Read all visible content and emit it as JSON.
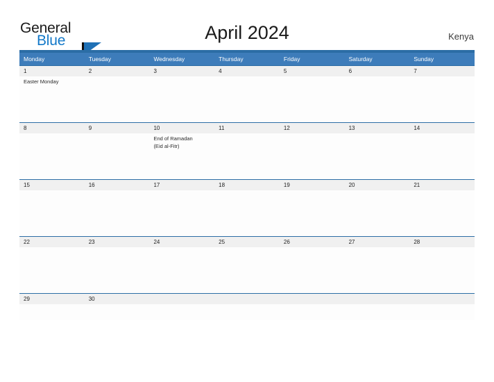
{
  "brand": {
    "name_part1": "General",
    "name_part2": "Blue",
    "accent_color": "#1278c8",
    "flag_color": "#1f70b5"
  },
  "header": {
    "title": "April 2024",
    "country": "Kenya",
    "rule_color": "#2b6da5",
    "weekday_header_bg": "#3d7cba"
  },
  "weekdays": [
    {
      "label": "Monday"
    },
    {
      "label": "Tuesday"
    },
    {
      "label": "Wednesday"
    },
    {
      "label": "Thursday"
    },
    {
      "label": "Friday"
    },
    {
      "label": "Saturday"
    },
    {
      "label": "Sunday"
    }
  ],
  "weeks": [
    {
      "days": [
        {
          "num": "1",
          "events": [
            "Easter Monday"
          ]
        },
        {
          "num": "2",
          "events": []
        },
        {
          "num": "3",
          "events": []
        },
        {
          "num": "4",
          "events": []
        },
        {
          "num": "5",
          "events": []
        },
        {
          "num": "6",
          "events": []
        },
        {
          "num": "7",
          "events": []
        }
      ]
    },
    {
      "days": [
        {
          "num": "8",
          "events": []
        },
        {
          "num": "9",
          "events": []
        },
        {
          "num": "10",
          "events": [
            "End of Ramadan",
            "(Eid al-Fitr)"
          ]
        },
        {
          "num": "11",
          "events": []
        },
        {
          "num": "12",
          "events": []
        },
        {
          "num": "13",
          "events": []
        },
        {
          "num": "14",
          "events": []
        }
      ]
    },
    {
      "days": [
        {
          "num": "15",
          "events": []
        },
        {
          "num": "16",
          "events": []
        },
        {
          "num": "17",
          "events": []
        },
        {
          "num": "18",
          "events": []
        },
        {
          "num": "19",
          "events": []
        },
        {
          "num": "20",
          "events": []
        },
        {
          "num": "21",
          "events": []
        }
      ]
    },
    {
      "days": [
        {
          "num": "22",
          "events": []
        },
        {
          "num": "23",
          "events": []
        },
        {
          "num": "24",
          "events": []
        },
        {
          "num": "25",
          "events": []
        },
        {
          "num": "26",
          "events": []
        },
        {
          "num": "27",
          "events": []
        },
        {
          "num": "28",
          "events": []
        }
      ]
    },
    {
      "days": [
        {
          "num": "29",
          "events": []
        },
        {
          "num": "30",
          "events": []
        },
        {
          "num": "",
          "events": []
        },
        {
          "num": "",
          "events": []
        },
        {
          "num": "",
          "events": []
        },
        {
          "num": "",
          "events": []
        },
        {
          "num": "",
          "events": []
        }
      ]
    }
  ]
}
